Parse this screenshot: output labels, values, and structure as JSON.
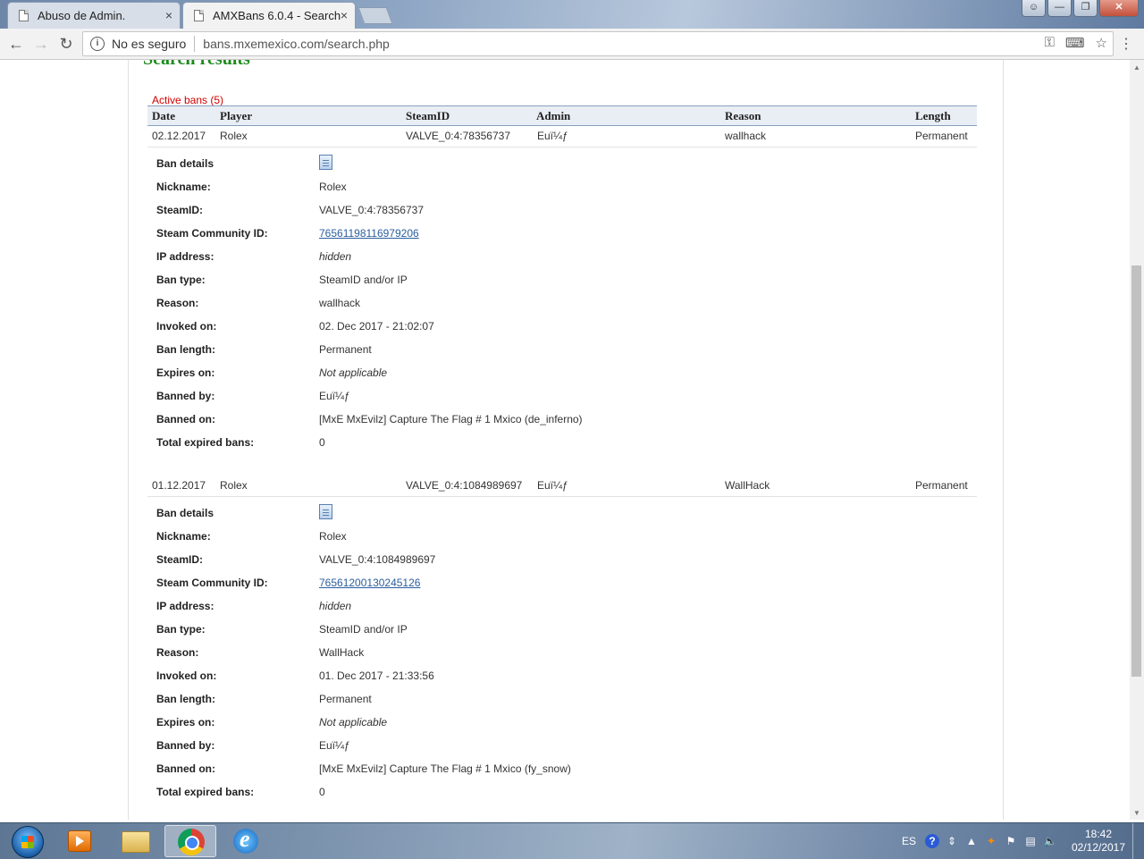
{
  "browser": {
    "tabs": [
      {
        "title": "Abuso de Admin."
      },
      {
        "title": "AMXBans 6.0.4 - Search"
      }
    ],
    "close_glyph": "×",
    "security_label": "No es seguro",
    "url": "bans.mxemexico.com/search.php"
  },
  "page": {
    "heading": "Search results",
    "active_bans_label": "Active bans (5)",
    "columns": [
      "Date",
      "Player",
      "SteamID",
      "Admin",
      "Reason",
      "Length"
    ],
    "detail_labels": {
      "ban_details": "Ban details",
      "nickname": "Nickname:",
      "steamid": "SteamID:",
      "community_id": "Steam Community ID:",
      "ip": "IP address:",
      "ban_type": "Ban type:",
      "reason": "Reason:",
      "invoked": "Invoked on:",
      "length": "Ban length:",
      "expires": "Expires on:",
      "banned_by": "Banned by:",
      "banned_on": "Banned on:",
      "total_expired": "Total expired bans:"
    },
    "bans": [
      {
        "date": "02.12.2017",
        "player": "Rolex",
        "steamid": "VALVE_0:4:78356737",
        "admin": "Euï¼ƒ",
        "reason": "wallhack",
        "length": "Permanent",
        "details": {
          "nickname": "Rolex",
          "steamid": "VALVE_0:4:78356737",
          "community_id": "76561198116979206",
          "ip": "hidden",
          "ban_type": "SteamID and/or IP",
          "reason": "wallhack",
          "invoked": "02. Dec 2017 - 21:02:07",
          "length": "Permanent",
          "expires": "Not applicable",
          "banned_by": "Euï¼ƒ",
          "banned_on": "[MxE MxEvilz] Capture The Flag # 1 Mxico (de_inferno)",
          "total_expired": "0"
        }
      },
      {
        "date": "01.12.2017",
        "player": "Rolex",
        "steamid": "VALVE_0:4:1084989697",
        "admin": "Euï¼ƒ",
        "reason": "WallHack",
        "length": "Permanent",
        "details": {
          "nickname": "Rolex",
          "steamid": "VALVE_0:4:1084989697",
          "community_id": "76561200130245126",
          "ip": "hidden",
          "ban_type": "SteamID and/or IP",
          "reason": "WallHack",
          "invoked": "01. Dec 2017 - 21:33:56",
          "length": "Permanent",
          "expires": "Not applicable",
          "banned_by": "Euï¼ƒ",
          "banned_on": "[MxE MxEvilz] Capture The Flag # 1 Mxico (fy_snow)",
          "total_expired": "0"
        }
      }
    ]
  },
  "taskbar": {
    "language": "ES",
    "time": "18:42",
    "date": "02/12/2017"
  }
}
